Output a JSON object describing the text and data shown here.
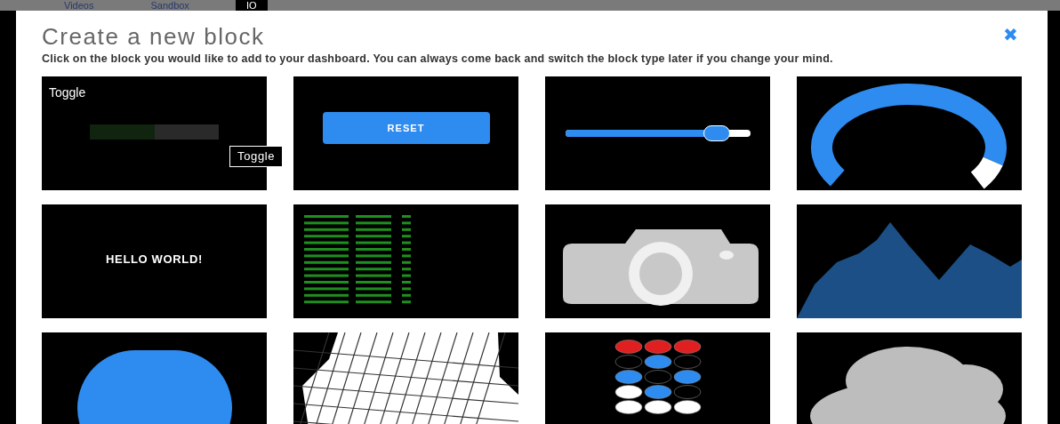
{
  "nav_tabs": [
    {
      "label": "Videos",
      "selected": false
    },
    {
      "label": "Sandbox",
      "selected": false
    },
    {
      "label": "IO",
      "selected": true
    }
  ],
  "dialog": {
    "title": "Create a new block",
    "close": "✖",
    "description": "Click on the block you would like to add to your dashboard. You can always come back and switch the block type later if you change your mind."
  },
  "tooltip": "Toggle",
  "blocks": [
    {
      "kind": "toggle",
      "label": "Toggle",
      "on": false
    },
    {
      "kind": "button",
      "label": "RESET"
    },
    {
      "kind": "slider",
      "level": 0.82
    },
    {
      "kind": "gauge"
    },
    {
      "kind": "text",
      "label": "HELLO WORLD!"
    },
    {
      "kind": "stream"
    },
    {
      "kind": "image"
    },
    {
      "kind": "chart"
    },
    {
      "kind": "indicator"
    },
    {
      "kind": "map"
    },
    {
      "kind": "remote"
    },
    {
      "kind": "weather"
    }
  ]
}
